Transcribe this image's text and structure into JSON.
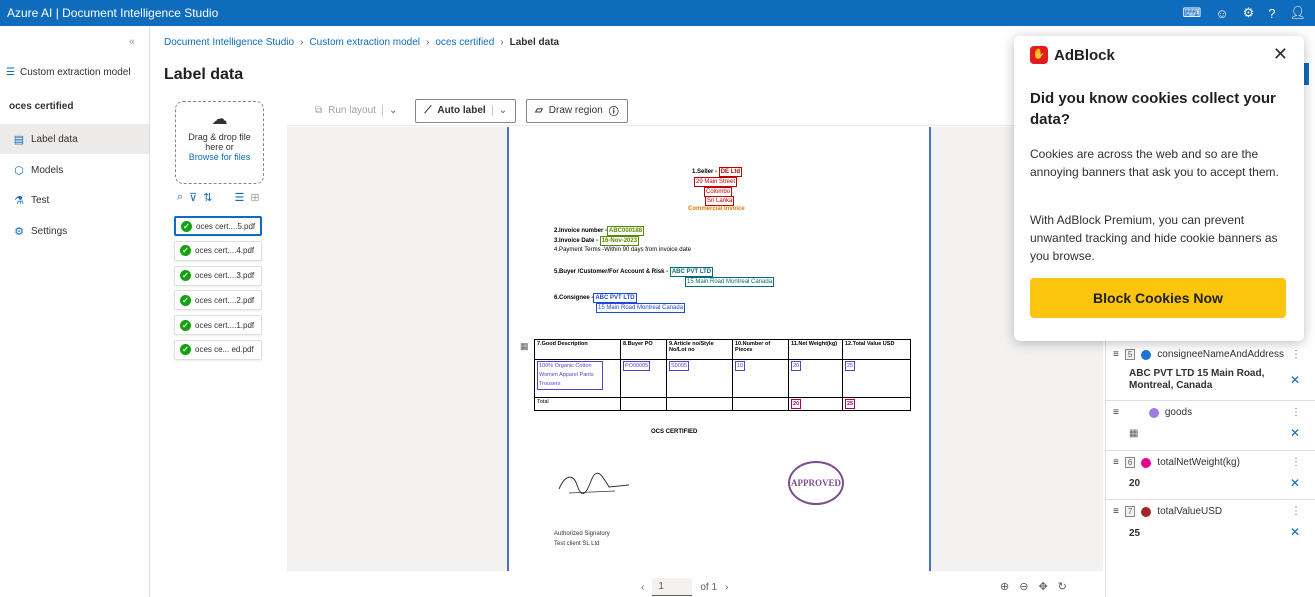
{
  "topbar": {
    "title": "Azure AI | Document Intelligence Studio"
  },
  "leftnav": {
    "model_label": "Custom extraction model",
    "project_name": "oces certified",
    "items": [
      {
        "label": "Label data",
        "icon": "document-icon"
      },
      {
        "label": "Models",
        "icon": "cube-icon"
      },
      {
        "label": "Test",
        "icon": "flask-icon"
      },
      {
        "label": "Settings",
        "icon": "gear-icon"
      }
    ]
  },
  "breadcrumb": [
    "Document Intelligence Studio",
    "Custom extraction model",
    "oces certified",
    "Label data"
  ],
  "page_title": "Label data",
  "dropzone": {
    "line1": "Drag & drop file",
    "line2": "here or",
    "link": "Browse for files"
  },
  "files": [
    "oces cert....5.pdf",
    "oces cert....4.pdf",
    "oces cert....3.pdf",
    "oces cert....2.pdf",
    "oces cert....1.pdf",
    "oces ce... ed.pdf"
  ],
  "toolbar": {
    "run_layout": "Run layout",
    "auto_label": "Auto label",
    "draw_region": "Draw region"
  },
  "document": {
    "seller_label": "1.Seller -",
    "seller_name": "DE Ltd",
    "seller_addr1": "29 Main Street",
    "seller_city": "Colombo",
    "seller_country": "Sri Lanka",
    "doc_type": "Commercial Invoice",
    "invoice_no_label": "2.Invoice number -",
    "invoice_no": "ABC000188",
    "invoice_date_label": "3.Invoice Date",
    "invoice_date": "16-Nov-2023",
    "payment_terms": "4.Payment Terms -Within 90 days from invoice date",
    "buyer_label": "5.Buyer /Customer/For Account & Risk -",
    "buyer_name": "ABC PVT LTD",
    "buyer_addr": "15 Main Road Montreal Canada",
    "consignee_label": "6.Consignee -",
    "consignee_name": "ABC PVT LTD",
    "consignee_addr": "15 Main Road Montreal Canada",
    "table_headers": [
      "7.Good Description",
      "8.Buyer PO",
      "9.Article no/Style No/Lot no",
      "10.Number of Pieces",
      "11.Net Weight(kg)",
      "12.Total Value USD"
    ],
    "goods_desc": "100% Organic Cotton Women Apparel Pants Trousers",
    "buyer_po": "PO00005",
    "article_no": "S0005",
    "pieces": "10",
    "net_weight": "20",
    "total_value": "25",
    "total_label": "Total",
    "total_weight": "20",
    "total_usd": "25",
    "certified": "OCS CERTIFIED",
    "stamp": "APPROVED",
    "signatory": "Authorized Signatory",
    "signatory_company": "Test client SL Ltd"
  },
  "pager": {
    "page": "1",
    "of": "of 1"
  },
  "fields": [
    {
      "num": "5",
      "name": "consigneeNameAndAddress",
      "color": "#1e73d8",
      "value_line1": "ABC PVT LTD 15 Main Road,",
      "value_line2": "Montreal, Canada"
    },
    {
      "num": "",
      "name": "goods",
      "color": "#9d7de8",
      "value_line1": "",
      "value_line2": ""
    },
    {
      "num": "6",
      "name": "totalNetWeight(kg)",
      "color": "#e3008c",
      "value_line1": "20",
      "value_line2": ""
    },
    {
      "num": "7",
      "name": "totalValueUSD",
      "color": "#a4262c",
      "value_line1": "25",
      "value_line2": ""
    }
  ],
  "adblock": {
    "brand": "AdBlock",
    "heading": "Did you know cookies collect your data?",
    "p1": "Cookies are across the web and so are the annoying banners that ask you to accept them.",
    "p2": "With AdBlock Premium, you can prevent unwanted tracking and hide cookie banners as you browse.",
    "button": "Block Cookies Now"
  }
}
